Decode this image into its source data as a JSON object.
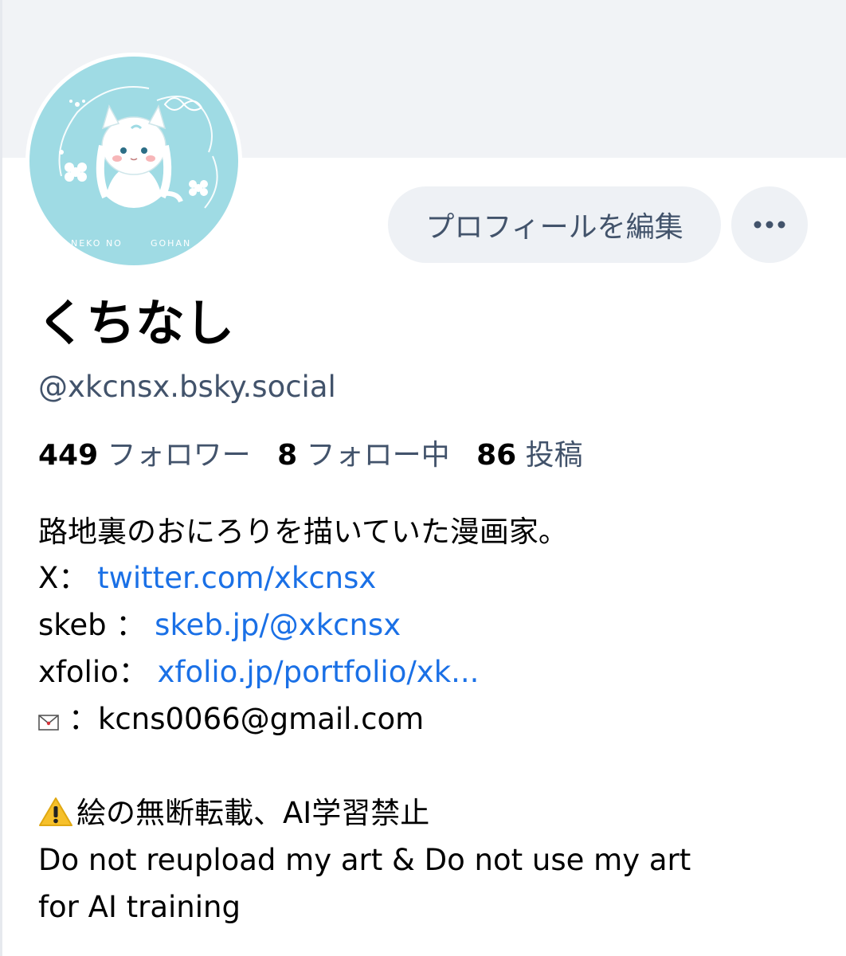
{
  "profile": {
    "display_name": "くちなし",
    "handle": "@xkcnsx.bsky.social",
    "avatar_text_left": "NEKO NO",
    "avatar_text_right": "GOHAN"
  },
  "actions": {
    "edit_profile_label": "プロフィールを編集",
    "more_label": "•••"
  },
  "stats": {
    "followers_count": "449",
    "followers_label": "フォロワー",
    "following_count": "8",
    "following_label": "フォロー中",
    "posts_count": "86",
    "posts_label": "投稿"
  },
  "bio": {
    "intro": "路地裏のおにろりを描いていた漫画家。",
    "x_prefix": "X：",
    "x_link": "twitter.com/xkcnsx",
    "skeb_prefix": "skeb ：",
    "skeb_link": "skeb.jp/@xkcnsx",
    "xfolio_prefix": "xfolio：",
    "xfolio_link": "xfolio.jp/portfolio/xk...",
    "mail_prefix": "：",
    "mail_value": "kcns0066@gmail.com",
    "warning": "絵の無断転載、AI学習禁止",
    "english_line1": "Do not reupload my art & Do not use my art",
    "english_line2": "for AI training"
  },
  "colors": {
    "link": "#1a70e6",
    "secondary_text": "#42536b",
    "button_bg": "#eef1f5",
    "banner_bg": "#f1f3f6",
    "avatar_bg": "#9fdbe4",
    "warning_yellow": "#f6c02b"
  }
}
